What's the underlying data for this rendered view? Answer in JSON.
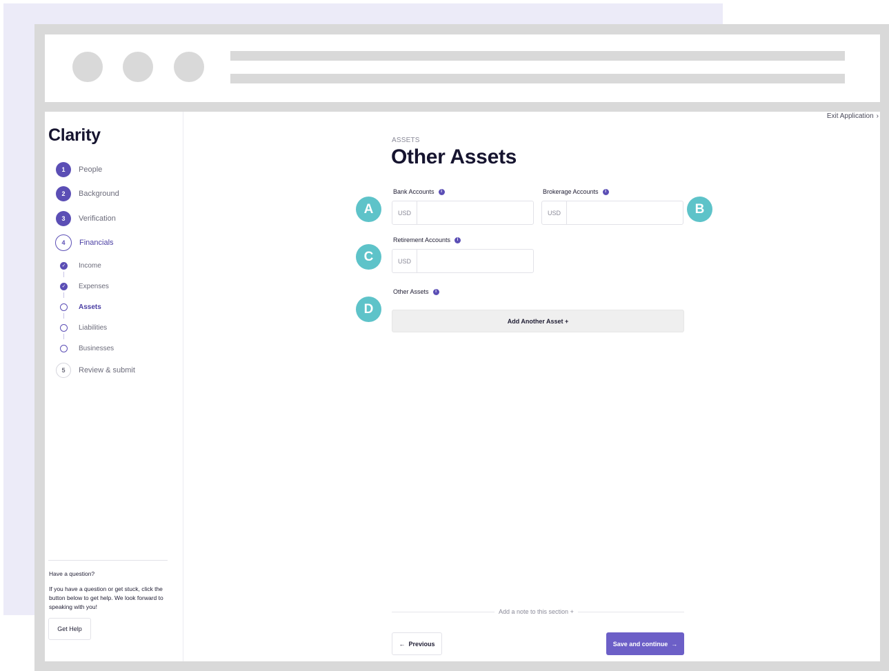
{
  "app": {
    "logo": "Clarity",
    "exit_label": "Exit Application",
    "exit_icon": "chevron-right-icon"
  },
  "colors": {
    "brand": "#5b4eb5",
    "button": "#6c5fc7",
    "badge": "#5ec3c9"
  },
  "sidebar": {
    "steps": [
      {
        "number": "1",
        "label": "People",
        "state": "complete"
      },
      {
        "number": "2",
        "label": "Background",
        "state": "complete"
      },
      {
        "number": "3",
        "label": "Verification",
        "state": "complete"
      },
      {
        "number": "4",
        "label": "Financials",
        "state": "current"
      },
      {
        "number": "5",
        "label": "Review & submit",
        "state": "upcoming"
      }
    ],
    "substeps": [
      {
        "label": "Income",
        "state": "done"
      },
      {
        "label": "Expenses",
        "state": "done"
      },
      {
        "label": "Assets",
        "state": "current"
      },
      {
        "label": "Liabilities",
        "state": "todo"
      },
      {
        "label": "Businesses",
        "state": "todo"
      }
    ],
    "help": {
      "title": "Have a question?",
      "text": "If you have a question or get stuck, click the button below to get help. We look forward to speaking with you!",
      "button": "Get Help"
    }
  },
  "main": {
    "eyebrow": "ASSETS",
    "title": "Other Assets",
    "fields": {
      "bank": {
        "label": "Bank Accounts",
        "currency": "USD",
        "value": ""
      },
      "brokerage": {
        "label": "Brokerage Accounts",
        "currency": "USD",
        "value": ""
      },
      "retirement": {
        "label": "Retirement Accounts",
        "currency": "USD",
        "value": ""
      },
      "other": {
        "label": "Other Assets"
      }
    },
    "add_asset_button": "Add Another Asset +",
    "note_link": "Add a note to this section +",
    "previous_button": "Previous",
    "save_button": "Save and continue"
  },
  "badges": [
    "A",
    "B",
    "C",
    "D"
  ]
}
